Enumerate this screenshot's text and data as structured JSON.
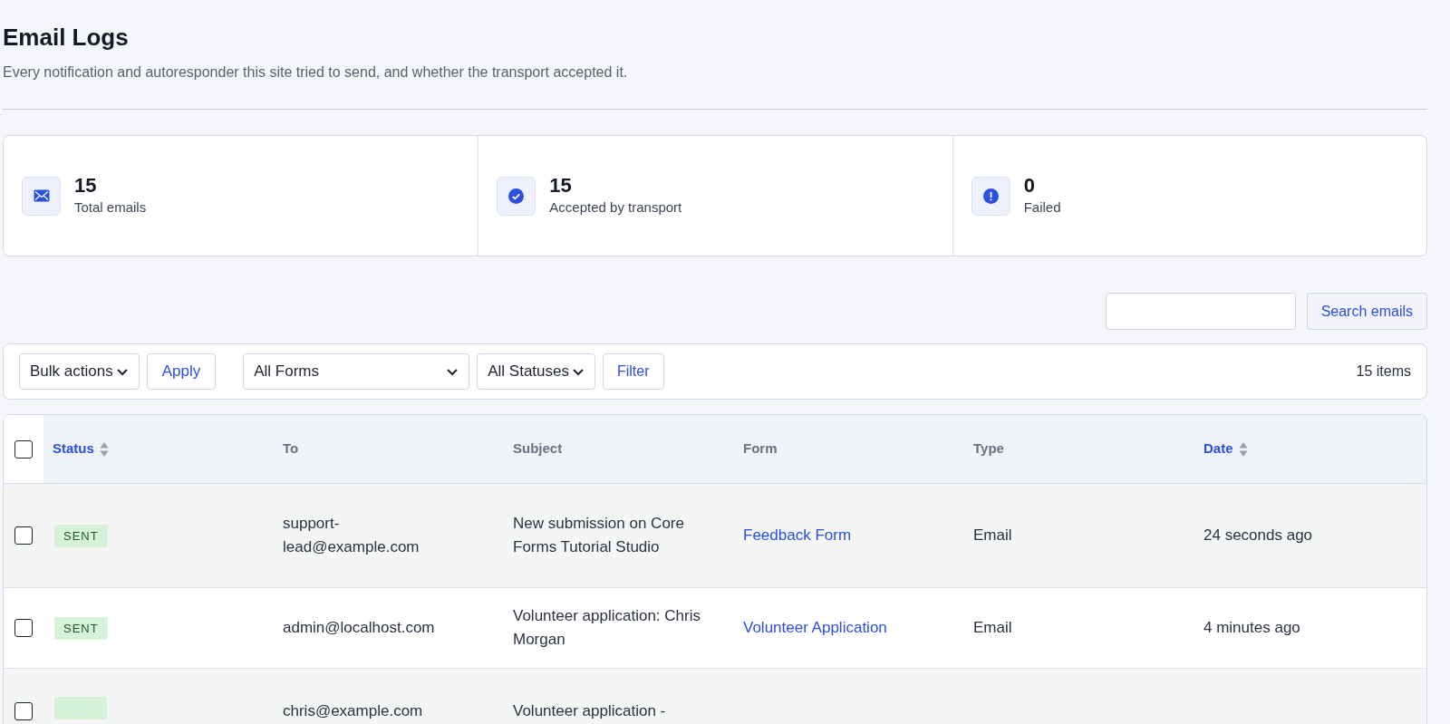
{
  "page": {
    "title": "Email Logs",
    "description": "Every notification and autoresponder this site tried to send, and whether the transport accepted it."
  },
  "stats": [
    {
      "kind": "mail",
      "value": "15",
      "label": "Total emails"
    },
    {
      "kind": "check",
      "value": "15",
      "label": "Accepted by transport"
    },
    {
      "kind": "alert",
      "value": "0",
      "label": "Failed"
    }
  ],
  "search": {
    "button": "Search emails"
  },
  "toolbar": {
    "bulk_actions": "Bulk actions",
    "apply": "Apply",
    "forms": "All Forms",
    "statuses": "All Statuses",
    "filter": "Filter",
    "count": "15 items"
  },
  "table": {
    "select_all": {
      "checked": false
    },
    "columns": [
      {
        "label": "Status",
        "sortable": true
      },
      {
        "label": "To",
        "sortable": false
      },
      {
        "label": "Subject",
        "sortable": false
      },
      {
        "label": "Form",
        "sortable": false
      },
      {
        "label": "Type",
        "sortable": false
      },
      {
        "label": "Date",
        "sortable": true
      }
    ],
    "rows": [
      {
        "checked": false,
        "status": "SENT",
        "color": "#d6f2d9",
        "to": "support-lead@example.com",
        "subject": "New submission on Core Forms Tutorial Studio",
        "form": "Feedback Form",
        "type": "Email",
        "date": "24 seconds ago"
      },
      {
        "checked": false,
        "status": "SENT",
        "color": "#d6f2d9",
        "to": "admin@localhost.com",
        "subject": "Volunteer application: Chris Morgan",
        "form": "Volunteer Application",
        "type": "Email",
        "date": "4 minutes ago"
      },
      {
        "checked": false,
        "color": "#d6f2d9",
        "to": "chris@example.com",
        "subject": "Volunteer application -"
      }
    ]
  }
}
